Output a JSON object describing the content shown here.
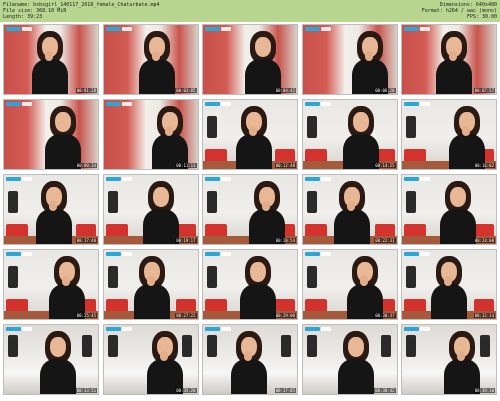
{
  "header": {
    "filename": "Filename: bsbsgirl_140117_2018_female_Chaturbate.mp4",
    "filesize": "File size: 368.10 MiB",
    "length": "Length: 39:23",
    "dimensions": "Dimensions: 640x480",
    "format": "Format: h264 / aac (mono)",
    "fps": "FPS: 30.00"
  },
  "colors": {
    "header_bg": "#b9d690",
    "badge": "#2aa7d7"
  },
  "thumbnails": [
    {
      "time": "00:01:28",
      "scene": "red"
    },
    {
      "time": "00:03:05",
      "scene": "red"
    },
    {
      "time": "00:04:42",
      "scene": "red"
    },
    {
      "time": "00:06:20",
      "scene": "red"
    },
    {
      "time": "00:07:57",
      "scene": "red"
    },
    {
      "time": "00:09:34",
      "scene": "red"
    },
    {
      "time": "00:11:11",
      "scene": "red"
    },
    {
      "time": "00:12:48",
      "scene": "room"
    },
    {
      "time": "00:14:25",
      "scene": "room"
    },
    {
      "time": "00:16:02",
      "scene": "room"
    },
    {
      "time": "00:17:40",
      "scene": "room"
    },
    {
      "time": "00:19:17",
      "scene": "room"
    },
    {
      "time": "00:20:54",
      "scene": "room"
    },
    {
      "time": "00:22:31",
      "scene": "room"
    },
    {
      "time": "00:24:08",
      "scene": "room"
    },
    {
      "time": "00:25:45",
      "scene": "room"
    },
    {
      "time": "00:27:22",
      "scene": "room"
    },
    {
      "time": "00:29:00",
      "scene": "room"
    },
    {
      "time": "00:30:37",
      "scene": "room"
    },
    {
      "time": "00:32:14",
      "scene": "room"
    },
    {
      "time": "00:33:51",
      "scene": "bed"
    },
    {
      "time": "00:35:28",
      "scene": "bed"
    },
    {
      "time": "00:37:05",
      "scene": "bed"
    },
    {
      "time": "00:38:42",
      "scene": "bed"
    },
    {
      "time": "00:39:10",
      "scene": "bed"
    }
  ]
}
